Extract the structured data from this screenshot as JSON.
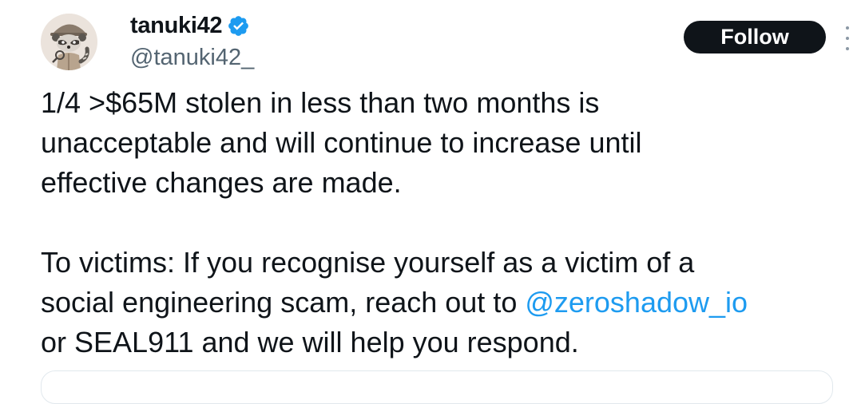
{
  "author": {
    "display_name": "tanuki42",
    "handle": "@tanuki42_",
    "verified": true,
    "avatar_icon": "raccoon-detective-avatar"
  },
  "actions": {
    "follow_label": "Follow",
    "more_icon": "more-options-icon"
  },
  "tweet": {
    "line1": "1/4 >$65M stolen in less than two months is",
    "line2": "unacceptable and will continue to increase until",
    "line3": "effective changes are made.",
    "line4": "To victims: If you recognise yourself as a victim of a",
    "line5_prefix": "social engineering scam, reach out to ",
    "line5_mention": "@zeroshadow_io",
    "line6": "or SEAL911 and we will help you respond."
  },
  "colors": {
    "text": "#0f1419",
    "secondary": "#536471",
    "link": "#1d9bf0",
    "verified_badge": "#1d9bf0",
    "follow_button_bg": "#0f1419"
  }
}
